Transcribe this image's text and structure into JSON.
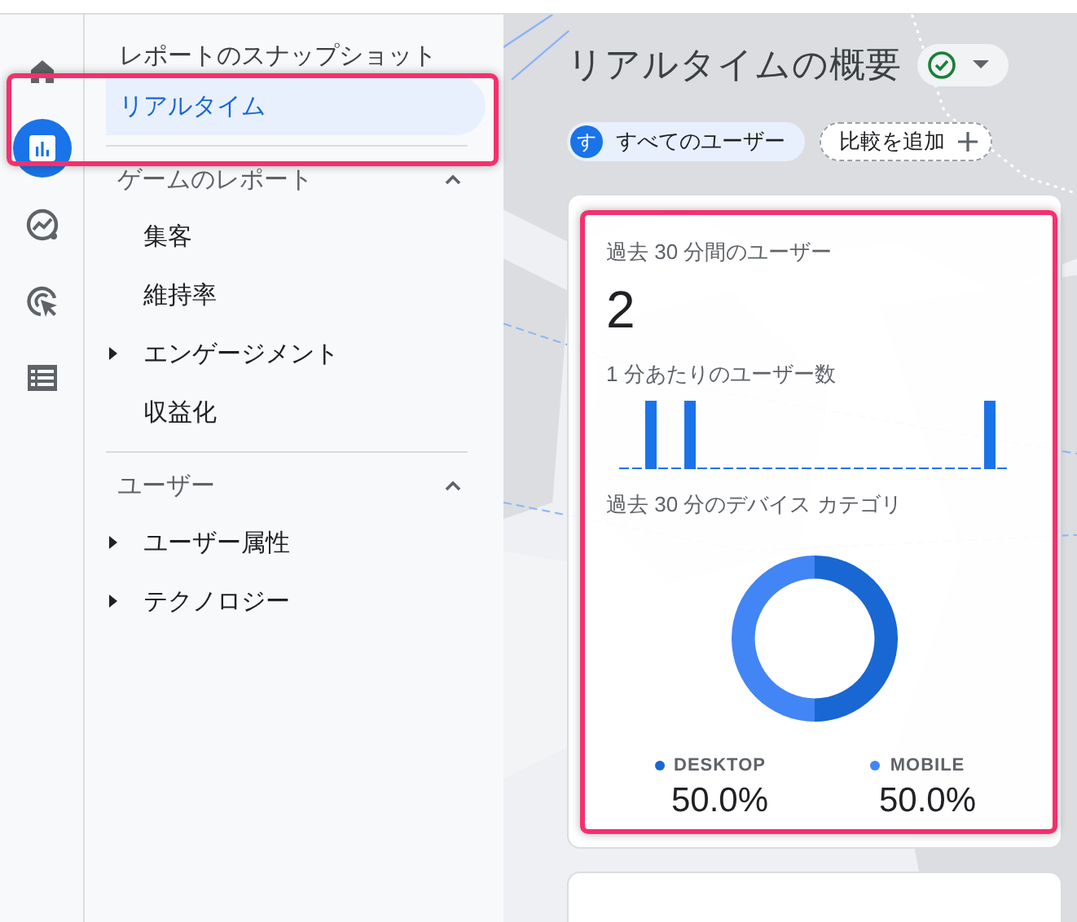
{
  "rail": {
    "items": [
      {
        "kind": "home",
        "selected": false
      },
      {
        "kind": "reports",
        "selected": true
      },
      {
        "kind": "explore",
        "selected": false
      },
      {
        "kind": "advertising",
        "selected": false
      },
      {
        "kind": "configure",
        "selected": false
      }
    ]
  },
  "nav": {
    "top_items": [
      {
        "label": "レポートのスナップショット",
        "selected": false
      },
      {
        "label": "リアルタイム",
        "selected": true
      }
    ],
    "sections": [
      {
        "title": "ゲームのレポート",
        "expanded": true,
        "items": [
          {
            "label": "集客",
            "expandable": false
          },
          {
            "label": "維持率",
            "expandable": false
          },
          {
            "label": "エンゲージメント",
            "expandable": true
          },
          {
            "label": "収益化",
            "expandable": false
          }
        ]
      },
      {
        "title": "ユーザー",
        "expanded": true,
        "items": [
          {
            "label": "ユーザー属性",
            "expandable": true
          },
          {
            "label": "テクノロジー",
            "expandable": true
          }
        ]
      }
    ]
  },
  "header": {
    "title": "リアルタイムの概要",
    "chips": [
      {
        "kind": "segment",
        "avatar": "す",
        "label": "すべてのユーザー"
      },
      {
        "kind": "add",
        "label": "比較を追加"
      }
    ]
  },
  "card": {
    "users_title": "過去 30 分間のユーザー",
    "users_count": "2",
    "per_minute_title": "1 分あたりのユーザー数",
    "device_title": "過去 30 分のデバイス カテゴリ",
    "chart_data": {
      "type": "donut",
      "categories": [
        "DESKTOP",
        "MOBILE"
      ],
      "values": [
        50,
        50
      ]
    },
    "legend": [
      {
        "color": "#1967d2",
        "share": "50.0%"
      },
      {
        "color": "#4285f4",
        "share": "50.0%"
      }
    ]
  }
}
